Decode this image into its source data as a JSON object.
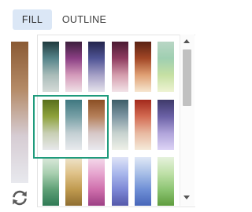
{
  "tabs": {
    "fill_label": "FILL",
    "outline_label": "OUTLINE"
  },
  "selected_tab": "fill",
  "icons": {
    "reset": "refresh-icon"
  },
  "colors": {
    "accent_selection": "#1f9b7c",
    "active_tab_bg": "#dbe7f6"
  },
  "preview_gradient": [
    "#8a5a34",
    "#b48a66",
    "#d6ccd3",
    "#e8e9ee"
  ],
  "gradients": [
    [
      [
        "#1f3a3d",
        "#55848a",
        "#a9bcb9",
        "#d6dbd8"
      ],
      [
        "#3c1f3d",
        "#8b3f84",
        "#d49aba",
        "#efe0e6"
      ],
      [
        "#23244c",
        "#4f5495",
        "#a5a0c6",
        "#e6e3ec"
      ],
      [
        "#4a1a32",
        "#8f3c60",
        "#d59dad",
        "#f2e3e8"
      ],
      [
        "#5a2113",
        "#a24726",
        "#e0a074",
        "#f6e6cf"
      ],
      [
        "#b9d6c5",
        "#9fcfb1",
        "#c6e0a3",
        "#eef3d3"
      ]
    ],
    [
      [
        "#596f1b",
        "#8ea23c",
        "#c8cfb4",
        "#e7e8eb"
      ],
      [
        "#3f7780",
        "#77a0a6",
        "#c3cfd3",
        "#e8eaed"
      ],
      [
        "#8b4f24",
        "#b5805a",
        "#d6c7c7",
        "#e9e9ee"
      ],
      [
        "#3d5d68",
        "#7e96a2",
        "#c7d2cf",
        "#eef0e8"
      ],
      [
        "#a3291c",
        "#d36b52",
        "#e8b9a1",
        "#f5ead9"
      ],
      [
        "#3f3a6a",
        "#6b61a6",
        "#b0a4da",
        "#ddd4f6"
      ]
    ],
    [
      [
        "#dce9dc",
        "#a9cfb0",
        "#5fa076",
        "#2f7a55"
      ],
      [
        "#efe4cc",
        "#dfc289",
        "#c09a4f",
        "#8f6e31"
      ],
      [
        "#f5dcec",
        "#e6a6cf",
        "#cf6fac",
        "#9c3f84"
      ],
      [
        "#dfe3f7",
        "#aab8ec",
        "#7d88d6",
        "#5458aa"
      ],
      [
        "#e0e8f6",
        "#a8bfe7",
        "#6f8fd6",
        "#4766b9"
      ],
      [
        "#e6f2dd",
        "#bfe0a8",
        "#8dc573",
        "#5f9c3e"
      ]
    ]
  ]
}
